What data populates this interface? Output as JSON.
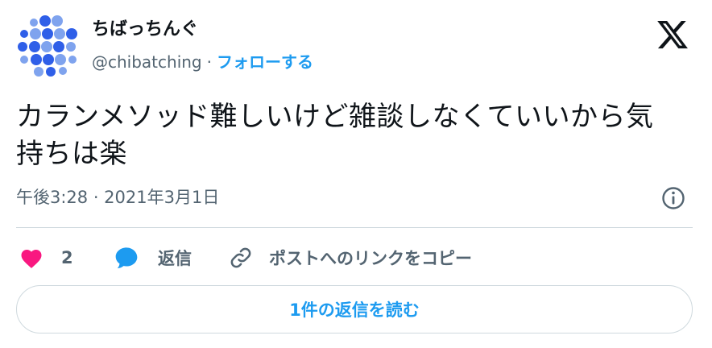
{
  "user": {
    "display_name": "ちばっちんぐ",
    "handle": "@chibatching",
    "separator": "·",
    "follow_label": "フォローする"
  },
  "tweet": {
    "text_line1": "カランメソッド難しいけど雑談しなくていいから気",
    "text_line2": "持ちは楽",
    "timestamp": "午後3:28 · 2021年3月1日"
  },
  "actions": {
    "like_count": "2",
    "reply_label": "返信",
    "copy_link_label": "ポストへのリンクをコピー"
  },
  "read_replies_label": "1件の返信を読む",
  "colors": {
    "accent": "#1d9bf0",
    "like": "#f91880",
    "avatar_blue": "#2f5fe8",
    "avatar_light": "#7fa3ee",
    "text_secondary": "#536471"
  },
  "icons": {
    "logo": "x-logo-icon",
    "info": "info-icon",
    "like": "heart-icon",
    "reply": "speech-bubble-icon",
    "copy": "link-icon"
  }
}
